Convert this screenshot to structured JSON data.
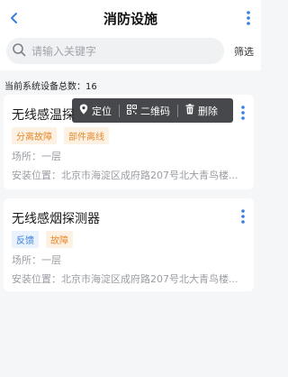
{
  "header": {
    "title": "消防设施",
    "back_icon": "chevron-left-icon",
    "more_icon": "more-vertical-icon",
    "accent": "#3a7ee0"
  },
  "search": {
    "placeholder": "请输入关键字",
    "value": "",
    "filter_label": "筛选"
  },
  "summary": {
    "label": "当前系统设备总数：",
    "count": "16"
  },
  "popup_menu": {
    "locate": "定位",
    "qrcode": "二维码",
    "delete": "删除"
  },
  "devices": [
    {
      "name": "无线感温探",
      "tags": [
        {
          "label": "分离故障",
          "color": "#e58a2c"
        },
        {
          "label": "部件离线",
          "color": "#e58a2c"
        }
      ],
      "location": "场所：一层",
      "address": "安装位置：北京市海淀区成府路207号北大青鸟楼..."
    },
    {
      "name": "无线感烟探测器",
      "tags": [
        {
          "label": "反馈",
          "color": "#3a7ee0"
        },
        {
          "label": "故障",
          "color": "#e58a2c"
        }
      ],
      "location": "场所：一层",
      "address": "安装位置：北京市海淀区成府路207号北大青鸟楼..."
    }
  ]
}
